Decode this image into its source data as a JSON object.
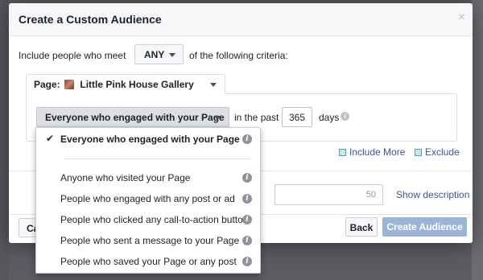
{
  "modal": {
    "title": "Create a Custom Audience",
    "close_glyph": "×"
  },
  "criteria": {
    "prefix": "Include people who meet",
    "match_value": "ANY",
    "suffix": "of the following criteria:"
  },
  "source": {
    "label": "Page:",
    "page_name": "Little Pink House Gallery"
  },
  "rule": {
    "engagement_type": "Everyone who engaged with your Page",
    "in_the_past": "in the past",
    "days_value": "365",
    "days_label": "days"
  },
  "actions": {
    "include_more": "Include More",
    "exclude": "Exclude"
  },
  "name_field": {
    "char_count": "50"
  },
  "show_description": "Show description",
  "footer": {
    "cancel": "Ca",
    "back": "Back",
    "create": "Create Audience"
  },
  "menu": {
    "selected": "Everyone who engaged with your Page",
    "items": [
      "Anyone who visited your Page",
      "People who engaged with any post or ad",
      "People who clicked any call-to-action button",
      "People who sent a message to your Page",
      "People who saved your Page or any post"
    ]
  },
  "info_glyph": "i",
  "check_glyph": "✔",
  "colors": {
    "link": "#365899",
    "primary_disabled": "#9cb4d8",
    "overlay": "#5a5c60"
  }
}
